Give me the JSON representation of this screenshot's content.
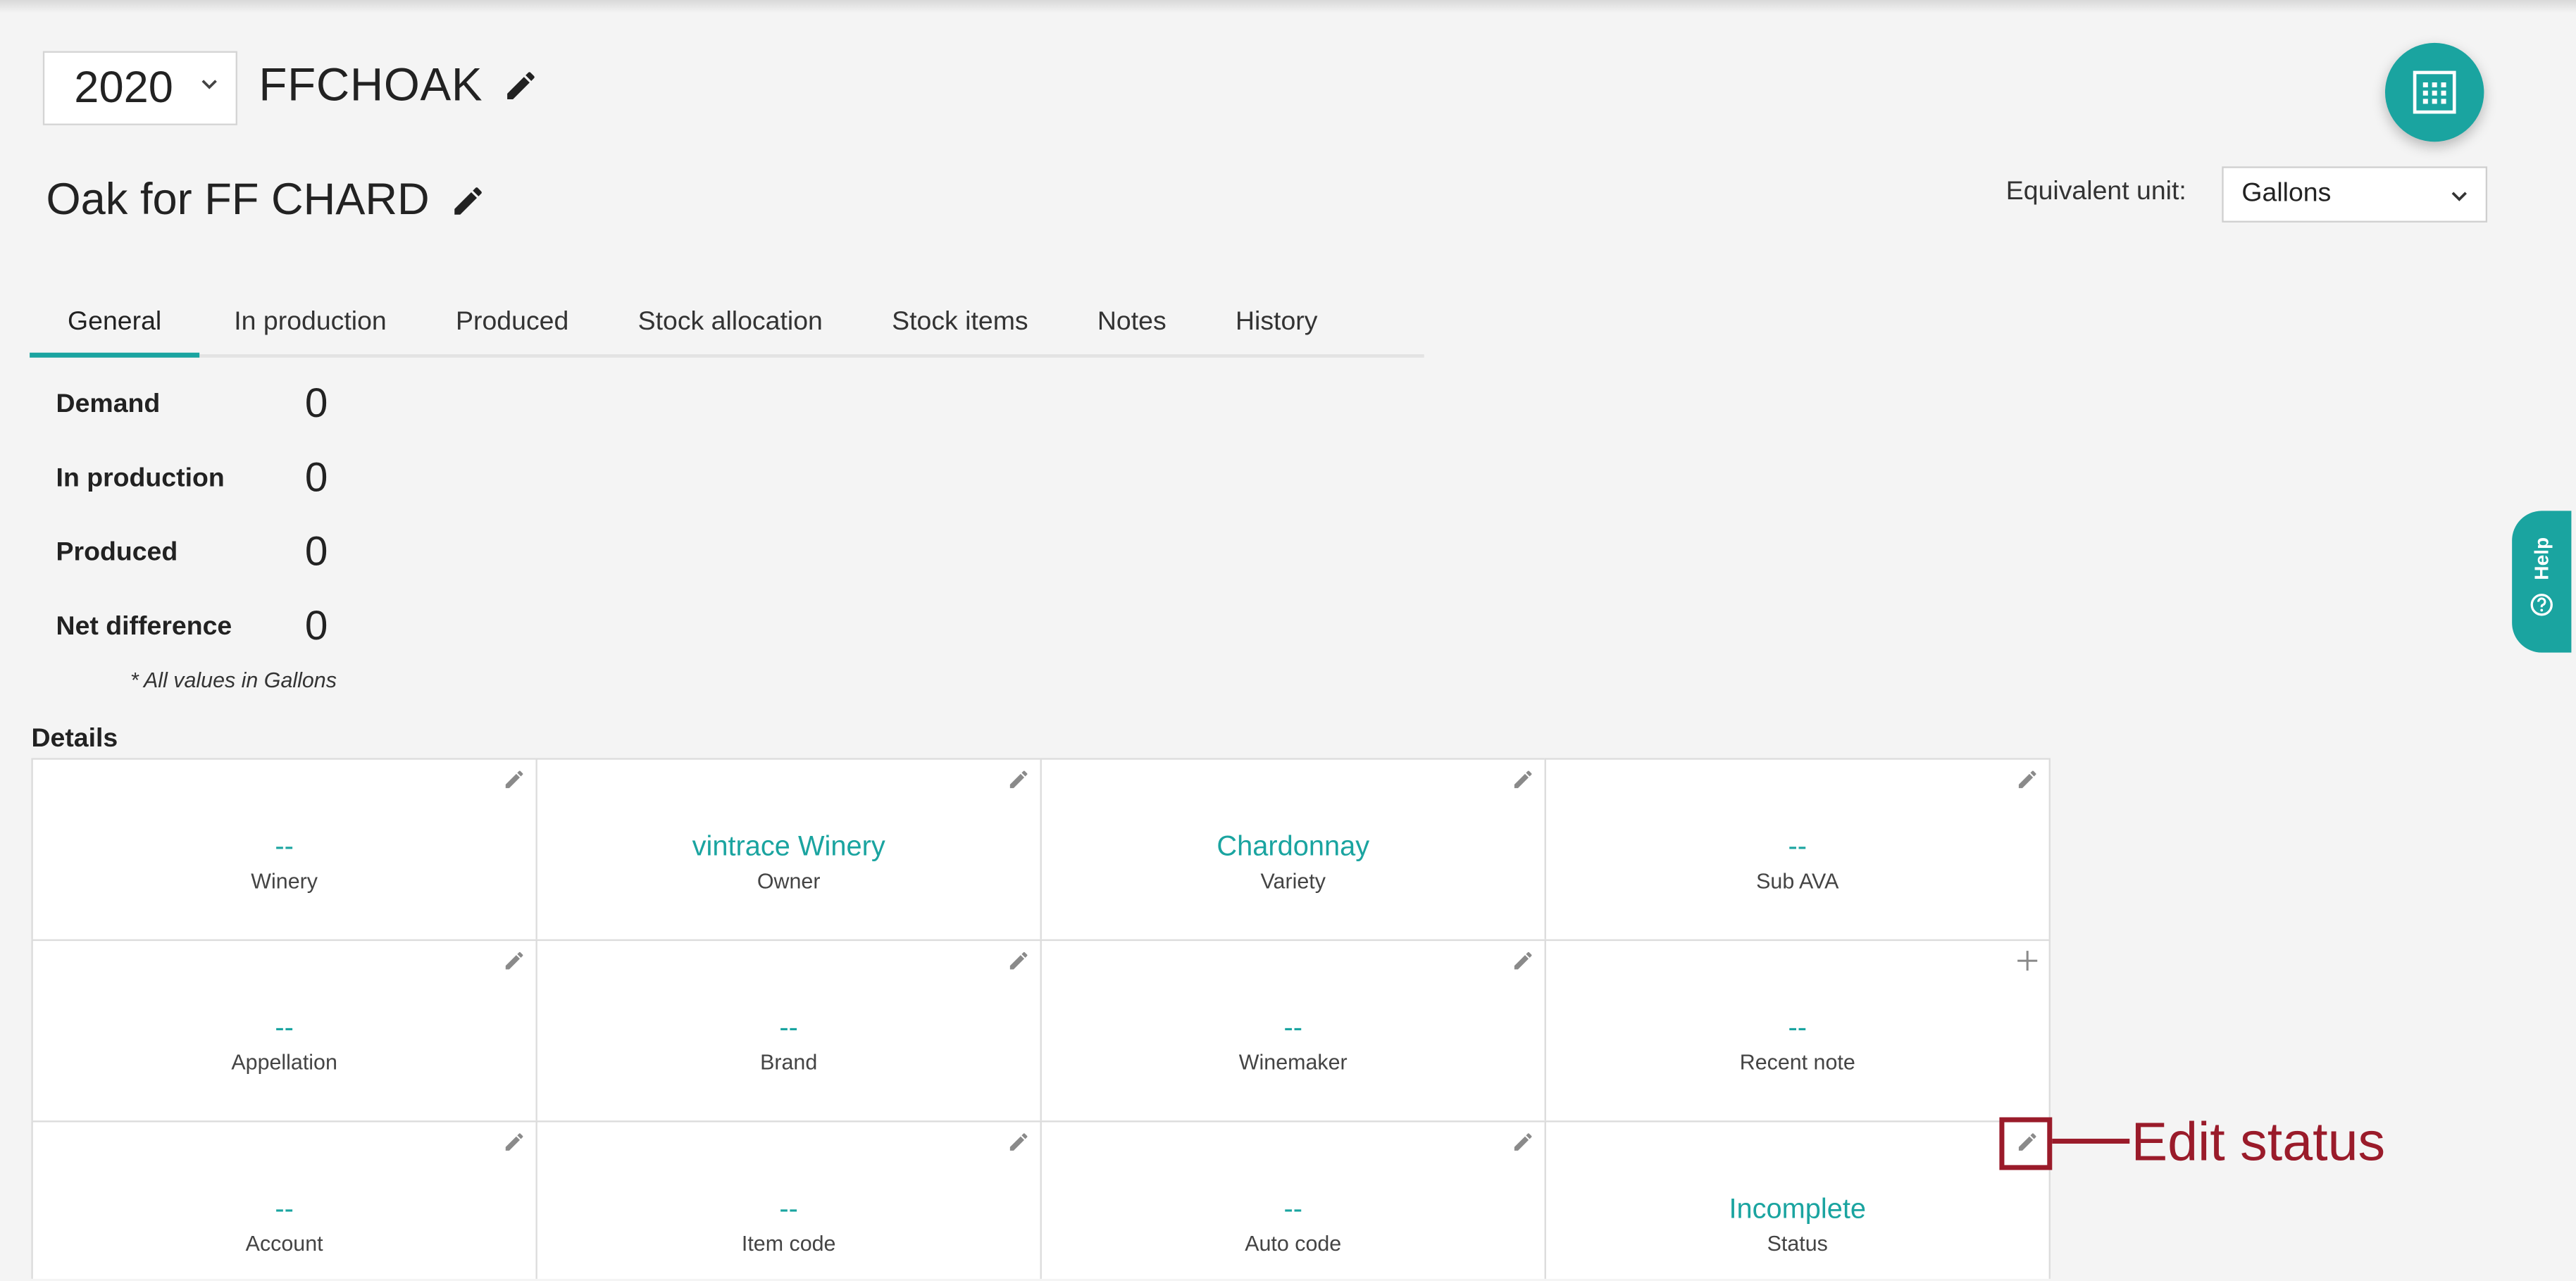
{
  "header": {
    "year": "2020",
    "batch_code": "FFCHOAK",
    "description": "Oak for FF CHARD"
  },
  "equivalent_unit": {
    "label": "Equivalent unit:",
    "value": "Gallons"
  },
  "tabs": [
    {
      "label": "General",
      "active": true
    },
    {
      "label": "In production"
    },
    {
      "label": "Produced"
    },
    {
      "label": "Stock allocation"
    },
    {
      "label": "Stock items"
    },
    {
      "label": "Notes"
    },
    {
      "label": "History"
    }
  ],
  "summary": [
    {
      "label": "Demand",
      "value": "0"
    },
    {
      "label": "In production",
      "value": "0"
    },
    {
      "label": "Produced",
      "value": "0"
    },
    {
      "label": "Net difference",
      "value": "0"
    }
  ],
  "note": "* All values in Gallons",
  "details": {
    "title": "Details",
    "cells": [
      {
        "value": "--",
        "label": "Winery",
        "action": "pencil-icon"
      },
      {
        "value": "vintrace Winery",
        "label": "Owner",
        "action": "pencil-icon"
      },
      {
        "value": "Chardonnay",
        "label": "Variety",
        "action": "pencil-icon"
      },
      {
        "value": "--",
        "label": "Sub AVA",
        "action": "pencil-icon"
      },
      {
        "value": "--",
        "label": "Appellation",
        "action": "pencil-icon"
      },
      {
        "value": "--",
        "label": "Brand",
        "action": "pencil-icon"
      },
      {
        "value": "--",
        "label": "Winemaker",
        "action": "pencil-icon"
      },
      {
        "value": "--",
        "label": "Recent note",
        "action": "plus-icon"
      },
      {
        "value": "--",
        "label": "Account",
        "action": "pencil-icon"
      },
      {
        "value": "--",
        "label": "Item code",
        "action": "pencil-icon"
      },
      {
        "value": "--",
        "label": "Auto code",
        "action": "pencil-icon"
      },
      {
        "value": "Incomplete",
        "label": "Status",
        "action": "pencil-icon"
      }
    ]
  },
  "help": {
    "label": "Help"
  },
  "annotation": {
    "text": "Edit status"
  },
  "colors": {
    "accent": "#1aa4a0",
    "annotation": "#9a1b2a"
  }
}
